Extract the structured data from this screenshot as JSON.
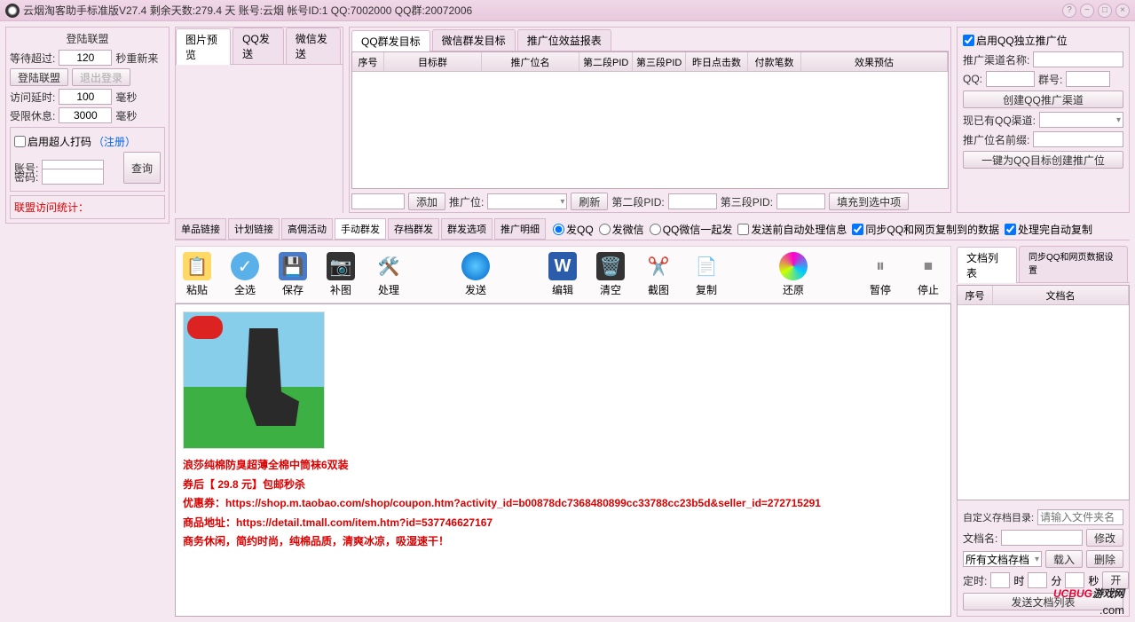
{
  "titlebar": "云烟淘客助手标准版V27.4   剩余天数:279.4 天   账号:云烟   帐号ID:1   QQ:7002000   QQ群:20072006",
  "login_panel": {
    "title": "登陆联盟",
    "wait_label": "等待超过:",
    "wait_value": "120",
    "wait_suffix": "秒重新来",
    "login_btn": "登陆联盟",
    "logout_btn": "退出登录",
    "delay_label": "访问延时:",
    "delay_value": "100",
    "delay_unit": "毫秒",
    "limit_label": "受限休息:",
    "limit_value": "3000",
    "limit_unit": "毫秒",
    "super_code": "启用超人打码",
    "register": "（注册）",
    "account": "账号:",
    "password": "密码:",
    "query": "查询",
    "stats": "联盟访问统计："
  },
  "upper_tabs": [
    "图片预览",
    "QQ发送",
    "微信发送"
  ],
  "target_tabs": [
    "QQ群发目标",
    "微信群发目标",
    "推广位效益报表"
  ],
  "target_table_headers": [
    "序号",
    "目标群",
    "推广位名",
    "第二段PID",
    "第三段PID",
    "昨日点击数",
    "付款笔数",
    "效果预估"
  ],
  "target_controls": {
    "add": "添加",
    "promo_label": "推广位:",
    "refresh": "刷新",
    "pid2": "第二段PID:",
    "pid3": "第三段PID:",
    "fill": "填充到选中项"
  },
  "qq_panel": {
    "enable": "启用QQ独立推广位",
    "channel_name": "推广渠道名称:",
    "qq_label": "QQ:",
    "group_label": "群号:",
    "create_btn": "创建QQ推广渠道",
    "existing": "现已有QQ渠道:",
    "prefix": "推广位名前缀:",
    "one_click": "一键为QQ目标创建推广位"
  },
  "mode_tabs": [
    "单品链接",
    "计划链接",
    "高佣活动",
    "手动群发",
    "存档群发",
    "群发选项",
    "推广明细"
  ],
  "radios": {
    "qq": "发QQ",
    "wx": "发微信",
    "both": "QQ微信一起发"
  },
  "checkboxes": {
    "pre": "发送前自动处理信息",
    "sync": "同步QQ和网页复制到的数据",
    "post": "处理完自动复制"
  },
  "toolbar": {
    "paste": "粘贴",
    "select_all": "全选",
    "save": "保存",
    "camera": "补图",
    "process": "处理",
    "send": "发送",
    "edit": "编辑",
    "clear": "清空",
    "screenshot": "截图",
    "copy": "复制",
    "restore": "还原",
    "pause": "暂停",
    "stop": "停止"
  },
  "product": {
    "line1": "浪莎纯棉防臭超薄全棉中筒袜6双装",
    "line2": "券后【 29.8 元】包邮秒杀",
    "line3": "优惠券：https://shop.m.taobao.com/shop/coupon.htm?activity_id=b00878dc7368480899cc33788cc23b5d&seller_id=272715291",
    "line4": "商品地址：https://detail.tmall.com/item.htm?id=537746627167",
    "line5": "商务休闲，简约时尚，纯棉品质，清爽冰凉，吸湿速干！"
  },
  "doc_tabs": [
    "文档列表",
    "同步QQ和网页数据设置"
  ],
  "doc_table_headers": [
    "序号",
    "文档名"
  ],
  "doc_controls": {
    "custom_dir": "自定义存档目录:",
    "dir_placeholder": "请输入文件夹名",
    "doc_name": "文档名:",
    "modify": "修改",
    "all_docs": "所有文档存档",
    "load": "载入",
    "delete": "删除",
    "timer": "定时:",
    "hour": "时",
    "min": "分",
    "sec": "秒",
    "start": "开启",
    "send_list": "发送文档列表"
  },
  "watermark": {
    "uc": "UCBUG",
    "rest": "游戏网",
    "sub": ".com"
  }
}
